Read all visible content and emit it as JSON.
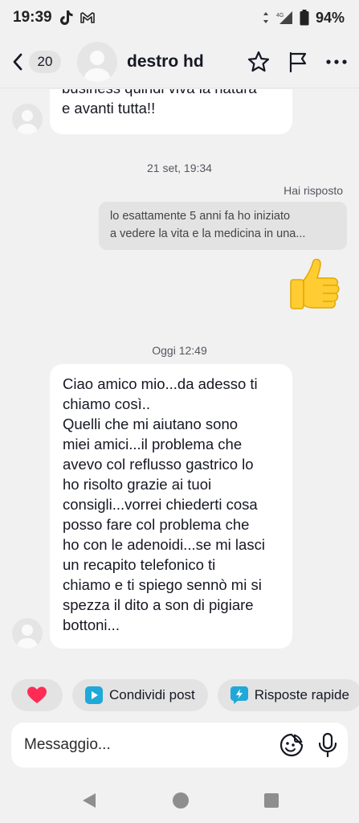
{
  "status_bar": {
    "time": "19:39",
    "battery": "94%",
    "network": "4G"
  },
  "header": {
    "unread_count": "20",
    "contact_name": "destro hd",
    "icons": [
      "back-chevron-icon",
      "star-icon",
      "flag-icon",
      "more-icon"
    ]
  },
  "messages": {
    "partial_incoming": {
      "line1": "business quindi viva la natura",
      "line2": "e avanti tutta!!"
    },
    "timestamp_1": "21 set, 19:34",
    "replied_label": "Hai risposto",
    "reply_preview": {
      "line1": "lo esattamente 5 anni fa ho iniziato",
      "line2": "a vedere la vita e la medicina in una..."
    },
    "reaction_emoji": "👍",
    "timestamp_2": "Oggi 12:49",
    "incoming_lines": [
      "Ciao amico mio...da adesso ti",
      "chiamo così..",
      "Quelli che mi aiutano sono",
      "miei amici...il problema che",
      "avevo col reflusso gastrico lo",
      "ho risolto grazie ai tuoi",
      "consigli...vorrei chiederti cosa",
      "posso fare col problema che",
      "ho con le adenoidi...se mi lasci",
      "un recapito telefonico ti",
      "chiamo e ti spiego sennò mi si",
      "spezza il dito a son di pigiare",
      "bottoni..."
    ]
  },
  "quick_actions": {
    "share_post": "Condividi post",
    "quick_replies": "Risposte rapide"
  },
  "composer": {
    "placeholder": "Messaggio..."
  },
  "colors": {
    "background": "#f1f1f2",
    "bubble_incoming": "#ffffff",
    "chip_bg": "#e3e3e4",
    "share_icon": "#20a8d8",
    "quick_reply_icon": "#20a8d8",
    "heart": "#fe2c55"
  }
}
